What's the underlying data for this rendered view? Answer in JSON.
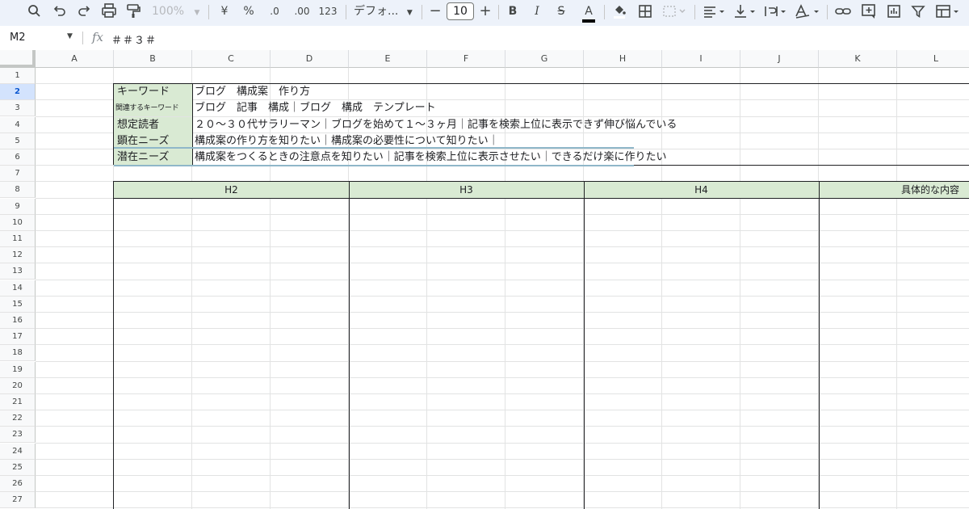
{
  "toolbar": {
    "zoom": "100%",
    "currency": "¥",
    "percent": "%",
    "dec_decrease": ".0",
    "dec_increase": ".00",
    "number_format": "123",
    "font_name": "デフォ...",
    "font_size": "10",
    "minus": "−",
    "plus": "+",
    "bold": "B",
    "italic": "I",
    "strike": "S",
    "text_color": "A"
  },
  "formula_bar": {
    "name_box": "M2",
    "fx": "fx",
    "value": "＃＃３＃"
  },
  "columns": [
    "A",
    "B",
    "C",
    "D",
    "E",
    "F",
    "G",
    "H",
    "I",
    "J",
    "K",
    "L"
  ],
  "rows": [
    "1",
    "2",
    "3",
    "4",
    "5",
    "6",
    "7",
    "8",
    "9",
    "10",
    "11",
    "12",
    "13",
    "14",
    "15",
    "16",
    "17",
    "18",
    "19",
    "20",
    "21",
    "22",
    "23",
    "24",
    "25",
    "26",
    "27"
  ],
  "info_rows": [
    {
      "label": "キーワード",
      "value": "ブログ　構成案　作り方"
    },
    {
      "label": "関連するキーワード",
      "value": "ブログ　記事　構成｜ブログ　構成　テンプレート"
    },
    {
      "label": "想定読者",
      "value": "２０〜３０代サラリーマン｜ブログを始めて１〜３ヶ月｜記事を検索上位に表示できず伸び悩んでいる"
    },
    {
      "label": "顕在ニーズ",
      "value": "構成案の作り方を知りたい｜構成案の必要性について知りたい｜"
    },
    {
      "label": "潜在ニーズ",
      "value": "構成案をつくるときの注意点を知りたい｜記事を検索上位に表示させたい｜できるだけ楽に作りたい"
    }
  ],
  "outline_headers": [
    "H2",
    "H3",
    "H4",
    "具体的な内容"
  ],
  "colors": {
    "label_fill": "#d9ead3",
    "selected_header": "#d3e3fd",
    "selection_border": "#8fb7c9"
  }
}
